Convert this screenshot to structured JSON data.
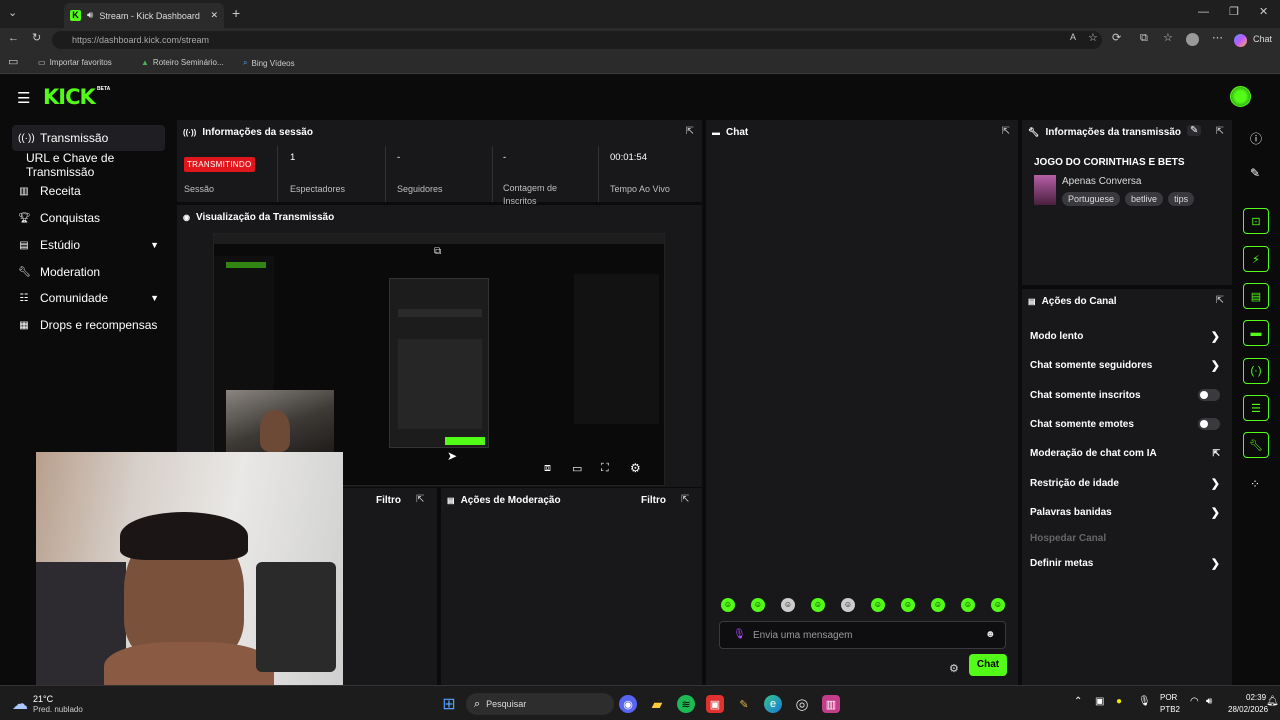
{
  "browser": {
    "tab_title": "Stream - Kick Dashboard",
    "url": "https://dashboard.kick.com/stream",
    "new_tab": "+",
    "chat_button": "Chat",
    "favorites": [
      "Importar favoritos",
      "Roteiro Seminário...",
      "Bing Vídeos"
    ]
  },
  "app": {
    "logo": "KICK",
    "logo_badge": "BETA",
    "sidebar": [
      {
        "label": "Transmissão",
        "icon": "broadcast-icon",
        "active": true
      },
      {
        "label": "URL e Chave de Transmissão",
        "icon": "",
        "active": false
      },
      {
        "label": "Receita",
        "icon": "chart-icon",
        "active": false
      },
      {
        "label": "Conquistas",
        "icon": "trophy-icon",
        "active": false
      },
      {
        "label": "Estúdio",
        "icon": "studio-icon",
        "active": false,
        "expandable": true
      },
      {
        "label": "Moderation",
        "icon": "wrench-icon",
        "active": false
      },
      {
        "label": "Comunidade",
        "icon": "community-icon",
        "active": false,
        "expandable": true
      },
      {
        "label": "Drops e recompensas",
        "icon": "drops-icon",
        "active": false
      }
    ]
  },
  "session": {
    "title": "Informações da sessão",
    "status_badge": "TRANSMITINDO",
    "status_label": "Sessão",
    "viewers_value": "1",
    "viewers_label": "Espectadores",
    "followers_value": "-",
    "followers_label": "Seguidores",
    "subs_value": "-",
    "subs_label": "Contagem de Inscritos",
    "uptime_value": "00:01:54",
    "uptime_label": "Tempo Ao Vivo"
  },
  "preview": {
    "title": "Visualização da Transmissão"
  },
  "lower_left": {
    "filter": "Filtro"
  },
  "moderation": {
    "title": "Ações de Moderação",
    "filter": "Filtro"
  },
  "chat": {
    "title": "Chat",
    "placeholder": "Envia uma mensagem",
    "send_label": "Chat"
  },
  "stream_info": {
    "title": "Informações da transmissão",
    "stream_title": "JOGO DO CORINTHIAS E BETS",
    "category": "Apenas Conversa",
    "tags": [
      "Portuguese",
      "betlive",
      "tips"
    ]
  },
  "channel_actions": {
    "title": "Ações do Canal",
    "items": [
      {
        "label": "Modo lento",
        "control": "arrow"
      },
      {
        "label": "Chat somente seguidores",
        "control": "arrow"
      },
      {
        "label": "Chat somente inscritos",
        "control": "toggle"
      },
      {
        "label": "Chat somente emotes",
        "control": "toggle"
      },
      {
        "label": "Moderação de chat com IA",
        "control": "external"
      },
      {
        "label": "Restrição de idade",
        "control": "arrow"
      },
      {
        "label": "Palavras banidas",
        "control": "arrow"
      },
      {
        "label": "Hospedar Canal",
        "control": "disabled"
      },
      {
        "label": "Definir metas",
        "control": "arrow"
      }
    ]
  },
  "taskbar": {
    "temperature": "21°C",
    "weather": "Pred. nublado",
    "search": "Pesquisar",
    "language": "POR",
    "layout": "PTB2",
    "time": "02:39",
    "date": "28/02/2026"
  },
  "colors": {
    "accent": "#53fc18",
    "live_red": "#e0161c",
    "panel": "#18181b"
  }
}
